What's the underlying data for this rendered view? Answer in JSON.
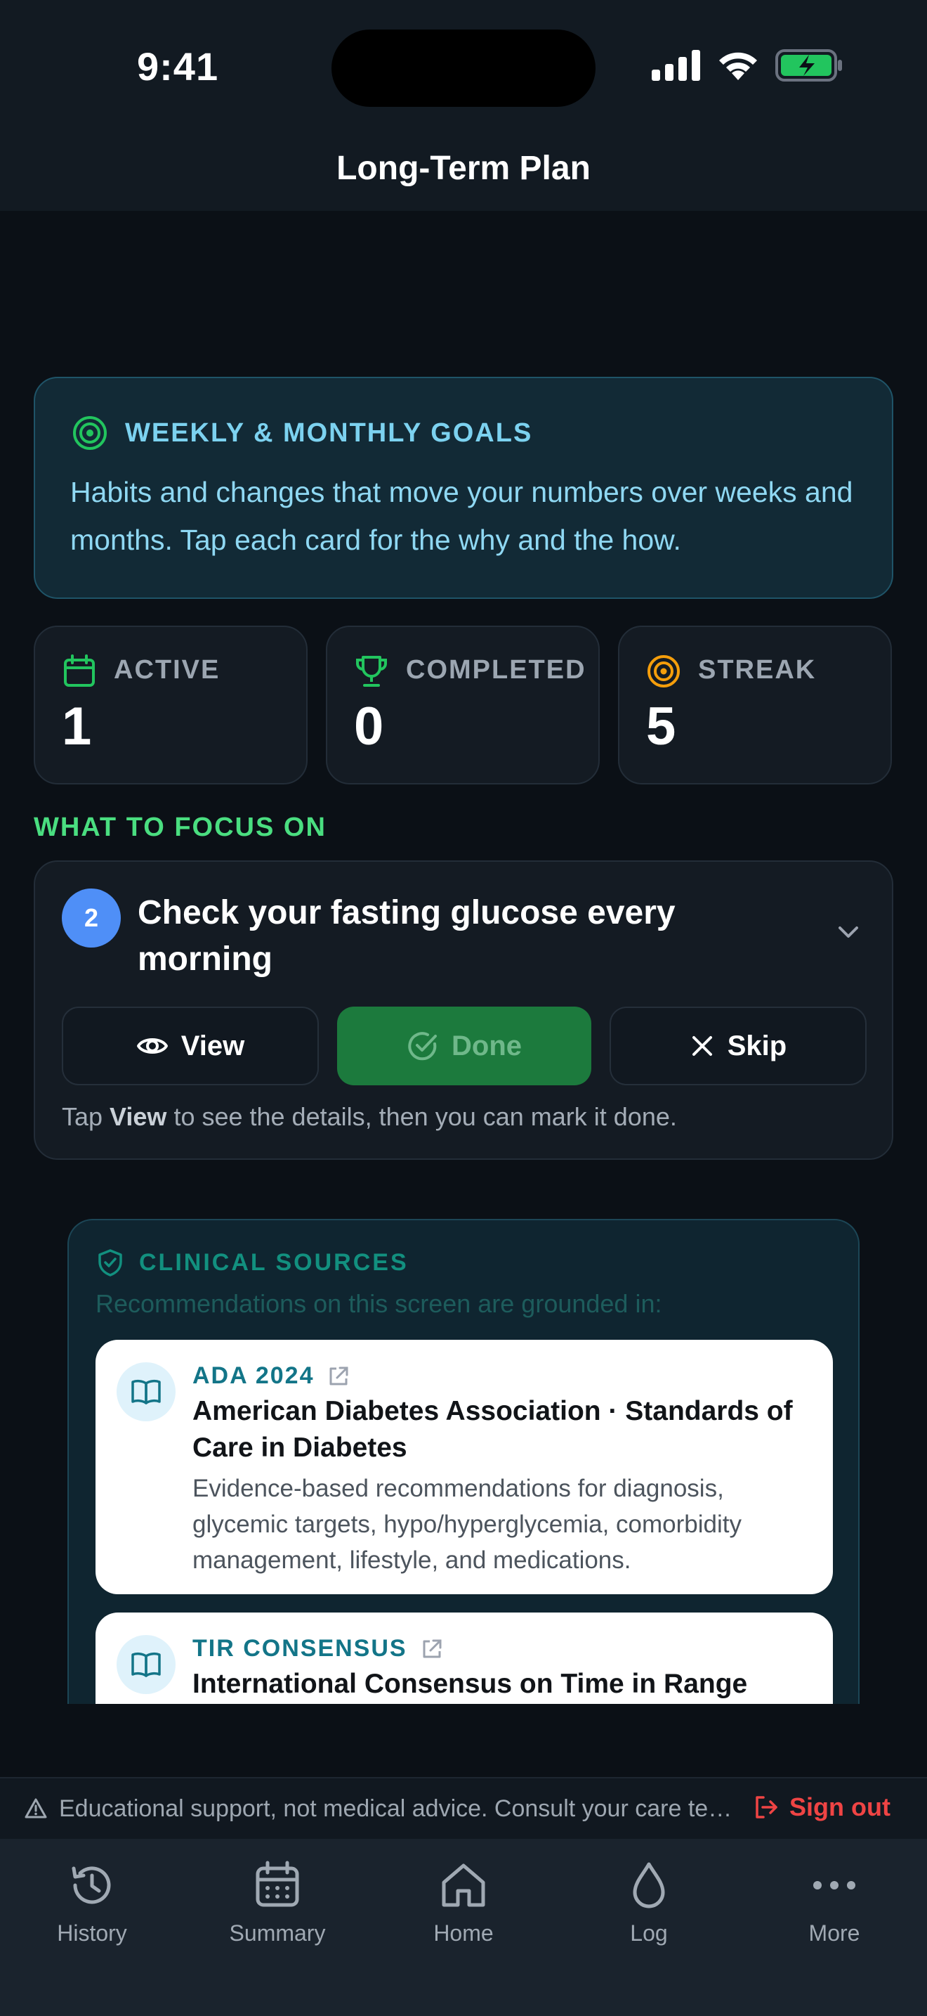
{
  "status_bar": {
    "time": "9:41"
  },
  "header": {
    "title": "Long-Term Plan"
  },
  "goals_banner": {
    "title": "WEEKLY & MONTHLY GOALS",
    "text": "Habits and changes that move your numbers over weeks and months. Tap each card for the why and the how.",
    "icon": "target-icon"
  },
  "stats": [
    {
      "label": "ACTIVE",
      "value": "1",
      "icon": "calendar-icon",
      "color": "#4ade80"
    },
    {
      "label": "COMPLETED",
      "value": "0",
      "icon": "trophy-icon",
      "color": "#4ade80"
    },
    {
      "label": "STREAK",
      "value": "5",
      "icon": "target-icon",
      "color": "#f59e0b"
    }
  ],
  "focus": {
    "section_label": "WHAT TO FOCUS ON",
    "badge": "2",
    "title": "Check your fasting glucose every morning",
    "view_label": "View",
    "done_label": "Done",
    "skip_label": "Skip",
    "hint_prefix": "Tap ",
    "hint_bold": "View",
    "hint_suffix": " to see the details, then you can mark it done."
  },
  "sources": {
    "title": "CLINICAL SOURCES",
    "subtitle": "Recommendations on this screen are grounded in:",
    "items": [
      {
        "tag": "ADA 2024",
        "name": "American Diabetes Association · Standards of Care in Diabetes",
        "description": "Evidence-based recommendations for diagnosis, glycemic targets, hypo/hyperglycemia, comorbidity management, lifestyle, and medications."
      },
      {
        "tag": "TIR CONSENSUS",
        "name": "International Consensus on Time in Range",
        "description": ""
      }
    ]
  },
  "disclaimer": {
    "text": "Educational support, not medical advice. Consult your care team before making changes.",
    "signout_label": "Sign out"
  },
  "tabbar": {
    "items": [
      {
        "label": "History",
        "icon": "history-icon"
      },
      {
        "label": "Summary",
        "icon": "calendar-icon"
      },
      {
        "label": "Home",
        "icon": "home-icon"
      },
      {
        "label": "Log",
        "icon": "drop-icon"
      },
      {
        "label": "More",
        "icon": "more-icon"
      }
    ]
  },
  "colors": {
    "background": "#0b1016",
    "accent_green": "#4ade80",
    "accent_blue": "#7cd2f0",
    "danger": "#ef4444",
    "done_button": "#1c7a3d"
  }
}
